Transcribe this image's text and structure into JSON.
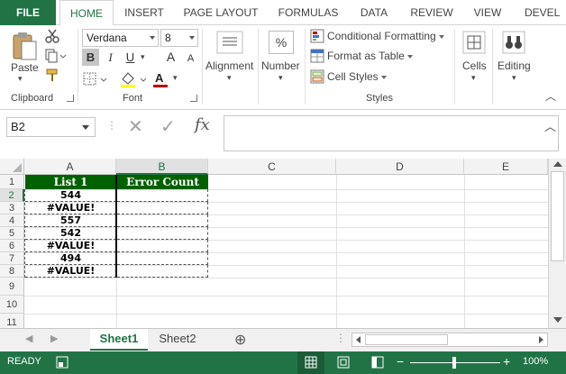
{
  "ribbon_tabs": [
    "FILE",
    "HOME",
    "INSERT",
    "PAGE LAYOUT",
    "FORMULAS",
    "DATA",
    "REVIEW",
    "VIEW",
    "DEVEL"
  ],
  "active_tab": "HOME",
  "clipboard": {
    "paste_label": "Paste",
    "group_label": "Clipboard"
  },
  "font": {
    "family_value": "Verdana",
    "size_value": "8",
    "group_label": "Font",
    "bold": "B",
    "italic": "I",
    "underline": "U",
    "grow": "A",
    "shrink": "A",
    "font_color": "A"
  },
  "alignment": {
    "label": "Alignment"
  },
  "number": {
    "label": "Number",
    "symbol": "%"
  },
  "styles": {
    "conditional": "Conditional Formatting",
    "format_table": "Format as Table",
    "cell_styles": "Cell Styles",
    "group_label": "Styles"
  },
  "cells": {
    "label": "Cells"
  },
  "editing": {
    "label": "Editing"
  },
  "formula_bar": {
    "name_box": "B2",
    "fx": "fx",
    "value": ""
  },
  "columns": [
    "A",
    "B",
    "C",
    "D",
    "E"
  ],
  "rows": [
    "1",
    "2",
    "3",
    "4",
    "5",
    "6",
    "7",
    "8",
    "9",
    "10",
    "11"
  ],
  "table": {
    "headers": [
      "List 1",
      "Error Count"
    ],
    "list_values": [
      "544",
      "#VALUE!",
      "557",
      "542",
      "#VALUE!",
      "494",
      "#VALUE!"
    ]
  },
  "sheets": [
    "Sheet1",
    "Sheet2"
  ],
  "active_sheet": "Sheet1",
  "status": {
    "ready": "READY",
    "zoom": "100%",
    "minus": "−",
    "plus": "+"
  },
  "colors": {
    "accent": "#217346",
    "header_fill": "#006100"
  }
}
